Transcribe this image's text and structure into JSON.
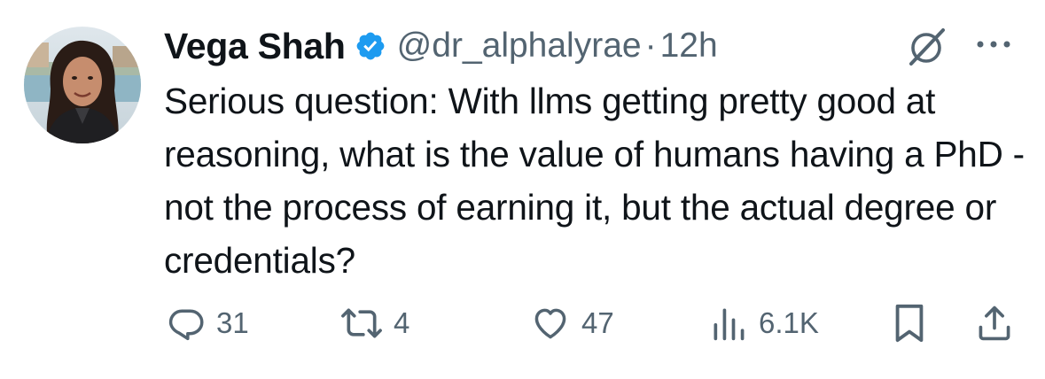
{
  "author": {
    "display_name": "Vega Shah",
    "handle": "@dr_alphalyrae",
    "separator": "·",
    "time": "12h",
    "avatar_icon": "profile-photo",
    "verified_icon": "verified-badge-icon"
  },
  "tweet": {
    "text": "Serious question: With llms getting pretty good at reasoning, what is the value of humans having a PhD - not the process of earning it, but the actual degree or credentials?"
  },
  "actions": {
    "replies": "31",
    "reposts": "4",
    "likes": "47",
    "views": "6.1K"
  },
  "colors": {
    "text": "#0f1419",
    "secondary": "#536471",
    "verified": "#1d9bf0"
  },
  "icons": [
    "grok-icon",
    "more-icon",
    "reply-icon",
    "repost-icon",
    "like-icon",
    "views-icon",
    "bookmark-icon",
    "share-icon"
  ]
}
